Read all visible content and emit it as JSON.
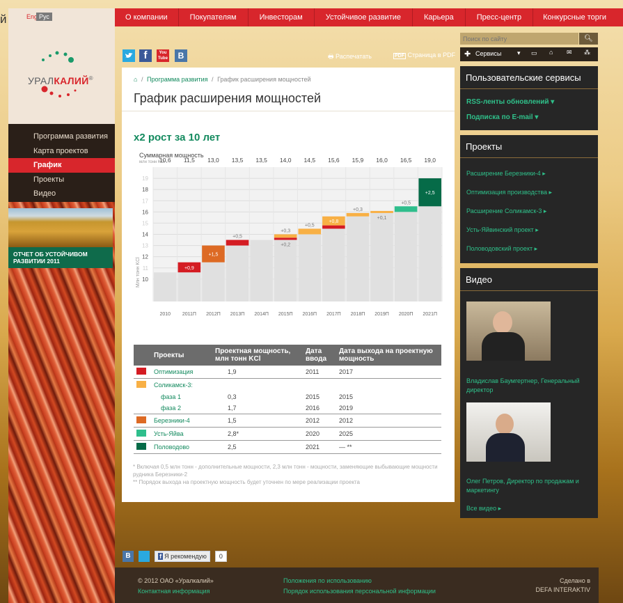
{
  "lang": {
    "eng": "Eng",
    "rus": "Рус"
  },
  "logo": {
    "brand_a": "УРАЛ",
    "brand_b": "КАЛИЙ",
    "reg": "®"
  },
  "leftnav": [
    "Программа развития",
    "Карта проектов",
    "График",
    "Проекты",
    "Видео"
  ],
  "report": {
    "label": "ОТЧЕТ ОБ УСТОЙЧИВОМ РАЗВИТИИ 2011"
  },
  "topnav": [
    "О компании",
    "Покупателям",
    "Инвесторам",
    "Устойчивое развитие",
    "Карьера",
    "Пресс-центр",
    "Конкурсные торги"
  ],
  "stray_letter": "й",
  "social": {
    "tw": "",
    "fb": "f",
    "yt": "You Tube",
    "vk": "B"
  },
  "actions": {
    "print": "Распечатать",
    "pdf": "Страница в PDF",
    "pdf_icon": "PDF"
  },
  "breadcrumb": {
    "home": "⌂",
    "link": "Программа развития",
    "sep": "/",
    "current": "График расширения мощностей"
  },
  "title": "График расширения мощностей",
  "growth": "x2 рост за 10 лет",
  "chart_data": {
    "type": "bar",
    "title": "Суммарная мощность",
    "subtitle": "млн тонн KCl",
    "ylabel": "Млн тонн KCl",
    "ylim": [
      8,
      20
    ],
    "yticks": [
      10,
      11,
      12,
      13,
      14,
      15,
      16,
      17,
      18,
      19
    ],
    "categories": [
      "2010",
      "2011П",
      "2012П",
      "2013П",
      "2014П",
      "2015П",
      "2016П",
      "2017П",
      "2018П",
      "2019П",
      "2020П",
      "2021П"
    ],
    "totals": [
      "10,6",
      "11,5",
      "13,0",
      "13,5",
      "13,5",
      "14,0",
      "14,5",
      "15,6",
      "15,9",
      "16,0",
      "16,5",
      "19,0"
    ],
    "base": [
      10.6,
      10.6,
      11.5,
      13.0,
      13.5,
      13.5,
      14.0,
      14.5,
      15.6,
      15.9,
      16.0,
      16.5
    ],
    "increments": [
      {
        "year": "2011П",
        "value": 0.9,
        "label": "+0,9",
        "color": "#d41c23"
      },
      {
        "year": "2012П",
        "value": 1.5,
        "label": "+1,5",
        "color": "#dd6a24"
      },
      {
        "year": "2013П",
        "value": 0.5,
        "label": "+0,5",
        "color": "#d41c23"
      },
      {
        "year": "2015П",
        "value": 0.2,
        "label": "+0,2",
        "color": "#d41c23"
      },
      {
        "year": "2015П",
        "value": 0.3,
        "label": "+0,3",
        "color": "#f8b045"
      },
      {
        "year": "2016П",
        "value": 0.5,
        "label": "+0,5",
        "color": "#f8b045"
      },
      {
        "year": "2017П",
        "value": 0.3,
        "label": "+0,3",
        "color": "#d41c23"
      },
      {
        "year": "2017П",
        "value": 0.8,
        "label": "+0,8",
        "color": "#f8b045"
      },
      {
        "year": "2018П",
        "value": 0.3,
        "label": "+0,3",
        "color": "#f8b045"
      },
      {
        "year": "2019П",
        "value": 0.1,
        "label": "+0,1",
        "color": "#f8b045"
      },
      {
        "year": "2020П",
        "value": 0.5,
        "label": "+0,5",
        "color": "#2fbe8c"
      },
      {
        "year": "2021П",
        "value": 2.5,
        "label": "+2,5",
        "color": "#066b48"
      }
    ]
  },
  "table": {
    "headers": [
      "Проекты",
      "Проектная мощность, млн тонн KCl",
      "Дата ввода",
      "Дата выхода на проектную мощность"
    ],
    "rows": [
      {
        "color": "#d41c23",
        "name": "Оптимизация",
        "cap": "1,9",
        "start": "2011",
        "full": "2017"
      },
      {
        "color": "#f8b045",
        "name": "Соликамск-3:",
        "cap": "",
        "start": "",
        "full": ""
      },
      {
        "color": "",
        "name": "фаза 1",
        "cap": "0,3",
        "start": "2015",
        "full": "2015"
      },
      {
        "color": "",
        "name": "фаза 2",
        "cap": "1,7",
        "start": "2016",
        "full": "2019"
      },
      {
        "color": "#dd6a24",
        "name": "Березники-4",
        "cap": "1,5",
        "start": "2012",
        "full": "2012"
      },
      {
        "color": "#2fbe8c",
        "name": "Усть-Яйва",
        "cap": "2,8*",
        "start": "2020",
        "full": "2025"
      },
      {
        "color": "#066b48",
        "name": "Половодово",
        "cap": "2,5",
        "start": "2021",
        "full": "— **"
      }
    ]
  },
  "notes": [
    "* Включая 0,5 млн тонн - дополнительные мощности, 2,3 млн тонн - мощности, заменяющие выбывающие мощности рудника Березники-2",
    "** Порядок выхода на проектную мощность будет уточнен по мере реализации проекта"
  ],
  "search": {
    "placeholder": "Поиск по сайту"
  },
  "services": {
    "label": "Сервисы"
  },
  "user_services": {
    "title": "Пользовательские сервисы",
    "links": [
      "RSS-ленты обновлений ▾",
      "Подписка по E-mail ▾"
    ]
  },
  "projects": {
    "title": "Проекты",
    "links": [
      "Расширение Березники-4 ▸",
      "Оптимизация производства ▸",
      "Расширение Соликамск-3 ▸",
      "Усть-Яйвинский проект ▸",
      "Половодовский проект ▸"
    ]
  },
  "video": {
    "title": "Видео",
    "items": [
      "Владислав Баумгертнер, Генеральный директор",
      "Олег Петров, Директор по продажам и маркетингу"
    ],
    "all": "Все видео ▸"
  },
  "bottom_social": {
    "vk": "B",
    "tw": "",
    "fb_like": "Я рекомендую",
    "count": "0"
  },
  "footer": {
    "copyright": "© 2012 ОАО «Уралкалий»",
    "contacts": "Контактная информация",
    "terms": "Положения по использованию",
    "privacy": "Порядок использования персональной информации",
    "made": "Сделано в",
    "agency": "DEFA INTERAKTIV"
  }
}
